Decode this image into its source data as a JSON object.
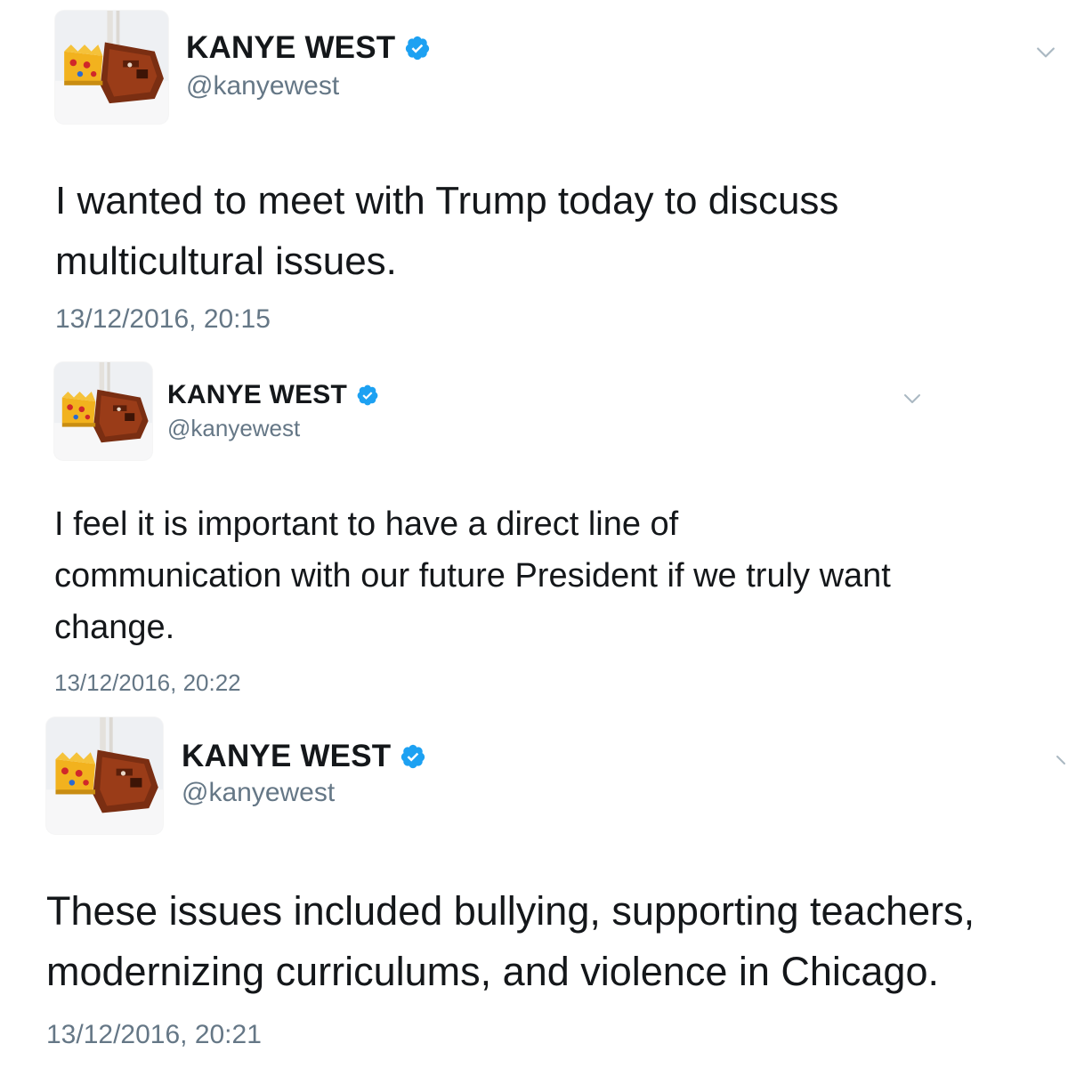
{
  "colors": {
    "verified_badge": "#1DA1F2",
    "name_text": "#14171A",
    "secondary_text": "#657786",
    "background": "#FFFFFF"
  },
  "tweets": [
    {
      "display_name": "KANYE WEST",
      "handle": "@kanyewest",
      "verified_icon": "verified-badge-icon",
      "menu_icon": "chevron-down-icon",
      "text": "I wanted to meet with Trump today to discuss\nmulticultural issues.",
      "timestamp": "13/12/2016, 20:15"
    },
    {
      "display_name": "KANYE WEST",
      "handle": "@kanyewest",
      "verified_icon": "verified-badge-icon",
      "menu_icon": "chevron-down-icon",
      "text": "I feel it is important to have a direct line of\ncommunication with our future President if we truly want\nchange.",
      "timestamp": "13/12/2016, 20:22"
    },
    {
      "display_name": "KANYE WEST",
      "handle": "@kanyewest",
      "verified_icon": "verified-badge-icon",
      "menu_icon": "chevron-down-icon",
      "text": "These issues included bullying, supporting teachers,\nmodernizing curriculums, and violence in Chicago.",
      "timestamp": "13/12/2016, 20:21"
    }
  ]
}
